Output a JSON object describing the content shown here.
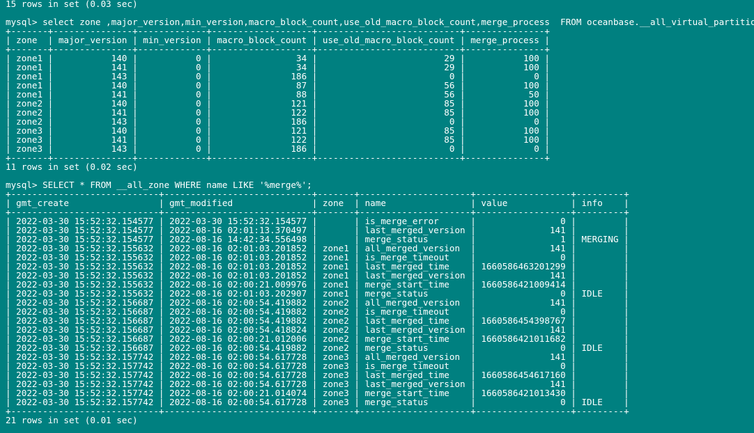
{
  "terminal": {
    "background": "#008080",
    "foreground": "#ffffff",
    "lines": [
      "15 rows in set (0.03 sec)",
      "",
      "mysql> select zone ,major_version,min_version,macro_block_count,use_old_macro_block_count,merge_process  FROM oceanbase.__all_virtual_partition_sstable_macro_info",
      "+-------+---------------+-------------+-------------------+---------------------------+---------------+",
      "| zone  | major_version | min_version | macro_block_count | use_old_macro_block_count | merge_process |",
      "+-------+---------------+-------------+-------------------+---------------------------+---------------+",
      "| zone1 |           140 |           0 |                34 |                        29 |           100 |",
      "| zone1 |           141 |           0 |                34 |                        29 |           100 |",
      "| zone1 |           143 |           0 |               186 |                         0 |             0 |",
      "| zone1 |           140 |           0 |                87 |                        56 |           100 |",
      "| zone1 |           141 |           0 |                88 |                        56 |            50 |",
      "| zone2 |           140 |           0 |               121 |                        85 |           100 |",
      "| zone2 |           141 |           0 |               122 |                        85 |           100 |",
      "| zone2 |           143 |           0 |               186 |                         0 |             0 |",
      "| zone3 |           140 |           0 |               121 |                        85 |           100 |",
      "| zone3 |           141 |           0 |               122 |                        85 |           100 |",
      "| zone3 |           143 |           0 |               186 |                         0 |             0 |",
      "+-------+---------------+-------------+-------------------+---------------------------+---------------+",
      "11 rows in set (0.02 sec)",
      "",
      "mysql> SELECT * FROM __all_zone WHERE name LIKE '%merge%';",
      "+----------------------------+----------------------------+-------+---------------------+------------------+---------+",
      "| gmt_create                 | gmt_modified               | zone  | name                | value            | info    |",
      "+----------------------------+----------------------------+-------+---------------------+------------------+---------+",
      "| 2022-03-30 15:52:32.154577 | 2022-03-30 15:52:32.154577 |       | is_merge_error      |                0 |         |",
      "| 2022-03-30 15:52:32.154577 | 2022-08-16 02:01:13.370497 |       | last_merged_version |              141 |         |",
      "| 2022-03-30 15:52:32.154577 | 2022-08-16 14:42:34.556498 |       | merge_status        |                1 | MERGING |",
      "| 2022-03-30 15:52:32.155632 | 2022-08-16 02:01:03.201852 | zone1 | all_merged_version  |              141 |         |",
      "| 2022-03-30 15:52:32.155632 | 2022-08-16 02:01:03.201852 | zone1 | is_merge_timeout    |                0 |         |",
      "| 2022-03-30 15:52:32.155632 | 2022-08-16 02:01:03.201852 | zone1 | last_merged_time    | 1660586463201299 |         |",
      "| 2022-03-30 15:52:32.155632 | 2022-08-16 02:01:03.201852 | zone1 | last_merged_version |              141 |         |",
      "| 2022-03-30 15:52:32.155632 | 2022-08-16 02:00:21.009976 | zone1 | merge_start_time    | 1660586421009414 |         |",
      "| 2022-03-30 15:52:32.155632 | 2022-08-16 02:01:03.202907 | zone1 | merge_status        |                0 | IDLE    |",
      "| 2022-03-30 15:52:32.156687 | 2022-08-16 02:00:54.419882 | zone2 | all_merged_version  |              141 |         |",
      "| 2022-03-30 15:52:32.156687 | 2022-08-16 02:00:54.419882 | zone2 | is_merge_timeout    |                0 |         |",
      "| 2022-03-30 15:52:32.156687 | 2022-08-16 02:00:54.419882 | zone2 | last_merged_time    | 1660586454398767 |         |",
      "| 2022-03-30 15:52:32.156687 | 2022-08-16 02:00:54.418824 | zone2 | last_merged_version |              141 |         |",
      "| 2022-03-30 15:52:32.156687 | 2022-08-16 02:00:21.012006 | zone2 | merge_start_time    | 1660586421011682 |         |",
      "| 2022-03-30 15:52:32.156687 | 2022-08-16 02:00:54.419882 | zone2 | merge_status        |                0 | IDLE    |",
      "| 2022-03-30 15:52:32.157742 | 2022-08-16 02:00:54.617728 | zone3 | all_merged_version  |              141 |         |",
      "| 2022-03-30 15:52:32.157742 | 2022-08-16 02:00:54.617728 | zone3 | is_merge_timeout    |                0 |         |",
      "| 2022-03-30 15:52:32.157742 | 2022-08-16 02:00:54.617728 | zone3 | last_merged_time    | 1660586454617160 |         |",
      "| 2022-03-30 15:52:32.157742 | 2022-08-16 02:00:54.617728 | zone3 | last_merged_version |              141 |         |",
      "| 2022-03-30 15:52:32.157742 | 2022-08-16 02:00:21.014074 | zone3 | merge_start_time    | 1660586421013430 |         |",
      "| 2022-03-30 15:52:32.157742 | 2022-08-16 02:00:54.617728 | zone3 | merge_status        |                0 | IDLE    |",
      "+----------------------------+----------------------------+-------+---------------------+------------------+---------+",
      "21 rows in set (0.01 sec)"
    ]
  }
}
